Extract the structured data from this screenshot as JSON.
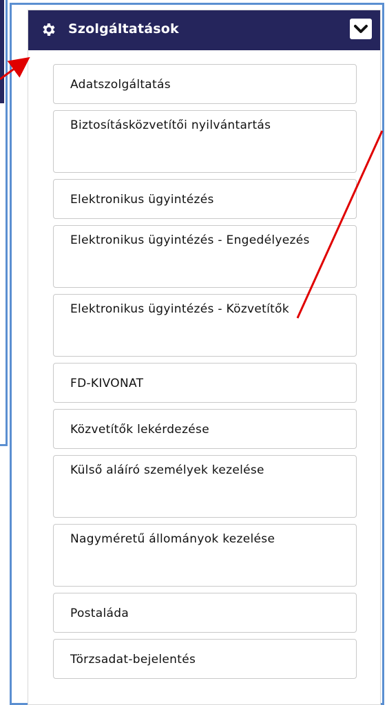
{
  "panel": {
    "title": "Szolgáltatások",
    "icon": "gear-icon",
    "toggle_icon": "chevron-down-icon",
    "header_color": "#25255c"
  },
  "items": [
    {
      "label": "Adatszolgáltatás"
    },
    {
      "label": "Biztosításközvetítői nyilvántartás"
    },
    {
      "label": "Elektronikus ügyintézés"
    },
    {
      "label": "Elektronikus ügyintézés - Engedélyezés"
    },
    {
      "label": "Elektronikus ügyintézés - Közvetítők"
    },
    {
      "label": "FD-KIVONAT"
    },
    {
      "label": "Közvetítők lekérdezése"
    },
    {
      "label": "Külső aláíró személyek kezelése"
    },
    {
      "label": "Nagyméretű állományok kezelése"
    },
    {
      "label": "Postaláda"
    },
    {
      "label": "Törzsadat-bejelentés"
    }
  ],
  "annotation_color": "#e00000",
  "highlight_color": "#5b8fd1"
}
